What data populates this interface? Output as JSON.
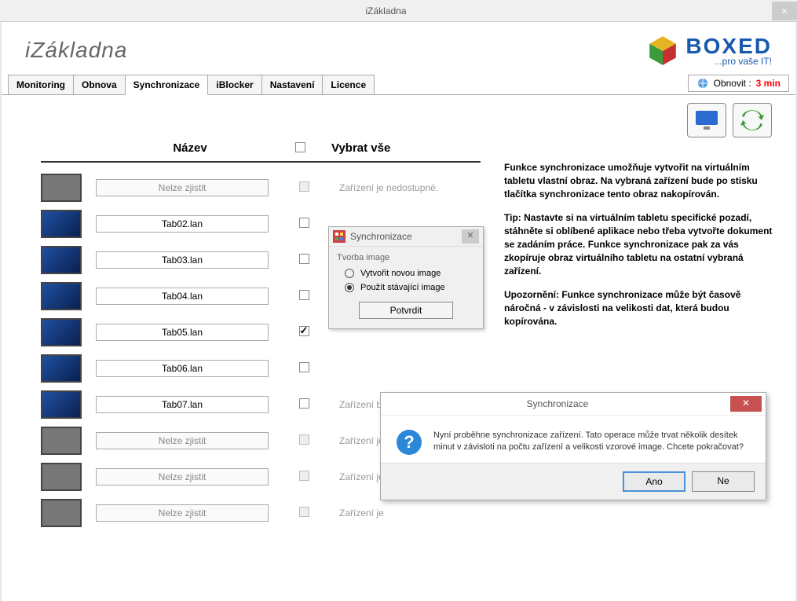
{
  "window": {
    "title": "iZákladna"
  },
  "logo_left": "iZákladna",
  "logo_right": {
    "brand": "BOXED",
    "tagline": "...pro vaše IT!"
  },
  "tabs": [
    {
      "label": "Monitoring",
      "active": false
    },
    {
      "label": "Obnova",
      "active": false
    },
    {
      "label": "Synchronizace",
      "active": true
    },
    {
      "label": "iBlocker",
      "active": false
    },
    {
      "label": "Nastavení",
      "active": false
    },
    {
      "label": "Licence",
      "active": false
    }
  ],
  "refresh": {
    "label": "Obnovit :",
    "value": "3 min"
  },
  "list_header": {
    "name": "Název",
    "select_all": "Vybrat vše"
  },
  "devices": [
    {
      "name": "Nelze zjistit",
      "online": false,
      "checked": false,
      "status": "Zařízení je nedostupné."
    },
    {
      "name": "Tab02.lan",
      "online": true,
      "checked": false,
      "status": ""
    },
    {
      "name": "Tab03.lan",
      "online": true,
      "checked": false,
      "status": ""
    },
    {
      "name": "Tab04.lan",
      "online": true,
      "checked": false,
      "status": ""
    },
    {
      "name": "Tab05.lan",
      "online": true,
      "checked": true,
      "status": ""
    },
    {
      "name": "Tab06.lan",
      "online": true,
      "checked": false,
      "status": ""
    },
    {
      "name": "Tab07.lan",
      "online": true,
      "checked": false,
      "status": "Zařízení bu"
    },
    {
      "name": "Nelze zjistit",
      "online": false,
      "checked": false,
      "status": "Zařízení je"
    },
    {
      "name": "Nelze zjistit",
      "online": false,
      "checked": false,
      "status": "Zařízení je"
    },
    {
      "name": "Nelze zjistit",
      "online": false,
      "checked": false,
      "status": "Zařízení je"
    }
  ],
  "info": {
    "p1_b": "Funkce synchronizace umožňuje vytvořit na virtuálním tabletu vlastní obraz. Na vybraná zařízení bude po stisku tlačítka synchronizace  tento obraz nakopírován.",
    "p2_b": "Tip: Nastavte si na virtuálním tabletu specifické pozadí, stáhněte si oblíbené aplikace nebo třeba vytvořte dokument se zadáním práce. Funkce synchronizace pak za vás zkopíruje obraz virtuálního tabletu na ostatní vybraná zařízení.",
    "p3_b": "Upozornění: Funkce synchronizace může být časově náročná - v závislosti na velikosti dat, která budou kopírována."
  },
  "popup_image": {
    "title": "Synchronizace",
    "group": "Tvorba image",
    "opt1": "Vytvořit novou image",
    "opt2": "Použít stávající image",
    "selected": 2,
    "confirm": "Potvrdit"
  },
  "popup_confirm": {
    "title": "Synchronizace",
    "message": "Nyní proběhne synchronizace zařízení. Tato operace může trvat několik desítek minut v závisloti na počtu zařízení a velikosti vzorové image. Chcete pokračovat?",
    "yes": "Ano",
    "no": "Ne"
  }
}
